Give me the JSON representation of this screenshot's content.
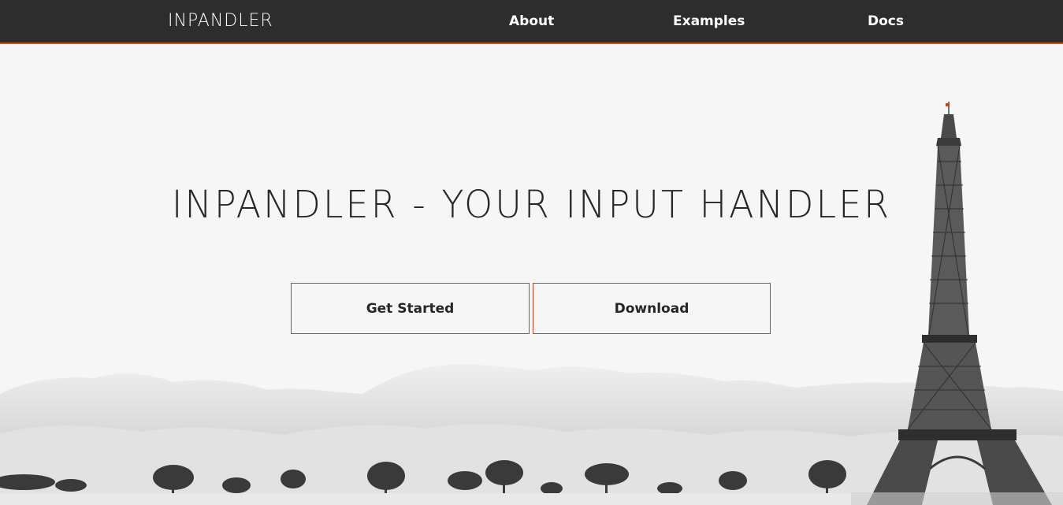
{
  "navbar": {
    "brand": "INPANDLER",
    "links": [
      {
        "label": "About"
      },
      {
        "label": "Examples"
      },
      {
        "label": "Docs"
      }
    ],
    "accent": "#d9501f"
  },
  "hero": {
    "title": "INPANDLER - YOUR INPUT HANDLER",
    "buttons": {
      "get_started": "Get Started",
      "download": "Download"
    }
  },
  "colors": {
    "navbar_bg": "#2d2d2d",
    "page_bg": "#f6f6f6",
    "button_border": "#c2451a",
    "text": "#262626"
  },
  "background": {
    "scene": "eiffel-tower-and-clouds-illustration"
  }
}
